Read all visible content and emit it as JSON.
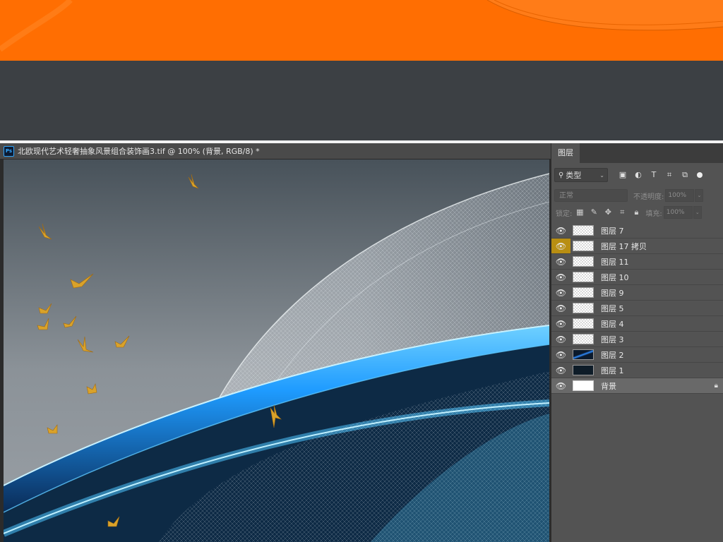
{
  "document": {
    "app_icon": "Ps",
    "title": "北欧现代艺术轻奢抽象风景组合装饰画3.tif @ 100% (背景, RGB/8) *"
  },
  "layers_panel": {
    "tab": "图层",
    "filter_kind": "类型",
    "filter_icons": [
      "image-filter-icon",
      "adjustment-filter-icon",
      "type-filter-icon",
      "shape-filter-icon",
      "smart-object-filter-icon"
    ],
    "blend_mode": "正常",
    "opacity_label": "不透明度:",
    "opacity_value": "100%",
    "lock_label": "锁定:",
    "lock_icons": [
      "lock-transparent-icon",
      "lock-paint-icon",
      "lock-position-icon",
      "lock-artboard-icon",
      "lock-all-icon"
    ],
    "fill_label": "填充:",
    "fill_value": "100%",
    "layers": [
      {
        "name": "图层 7"
      },
      {
        "name": "图层 17 拷贝",
        "highlight": true
      },
      {
        "name": "图层 11"
      },
      {
        "name": "图层 10"
      },
      {
        "name": "图层 9"
      },
      {
        "name": "图层 5"
      },
      {
        "name": "图层 4"
      },
      {
        "name": "图层 3"
      },
      {
        "name": "图层 2"
      },
      {
        "name": "图层 1"
      },
      {
        "name": "背景",
        "locked": true
      }
    ]
  },
  "colors": {
    "banner": "#ff6e02",
    "dark_band": "#3c4044",
    "panel": "#535353",
    "eye_highlight": "#b88e12",
    "wave_blue": "#1e9bff"
  }
}
